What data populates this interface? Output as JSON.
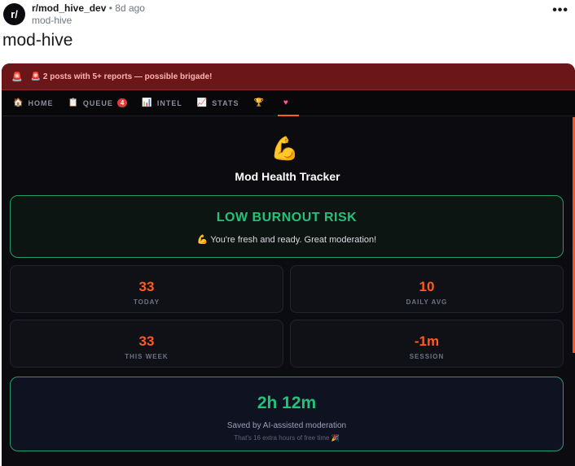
{
  "post": {
    "avatar_text": "r/",
    "subreddit": "r/mod_hive_dev",
    "separator": "•",
    "age": "8d ago",
    "author": "mod-hive",
    "more": "•••",
    "title": "mod-hive"
  },
  "alert": {
    "icon": "🚨",
    "text": "🚨 2 posts with 5+ reports — possible brigade!"
  },
  "nav": {
    "tabs": [
      {
        "icon": "🏠",
        "label": "HOME"
      },
      {
        "icon": "📋",
        "label": "QUEUE",
        "badge": "4"
      },
      {
        "icon": "📊",
        "label": "INTEL"
      },
      {
        "icon": "📈",
        "label": "STATS"
      },
      {
        "icon": "🏆",
        "label": ""
      },
      {
        "icon": "♥",
        "label": ""
      }
    ],
    "active_index": 5
  },
  "health": {
    "icon": "💪",
    "title": "Mod Health Tracker",
    "risk_title": "LOW BURNOUT RISK",
    "risk_sub": "💪 You're fresh and ready. Great moderation!",
    "stats": [
      {
        "value": "33",
        "label": "TODAY"
      },
      {
        "value": "10",
        "label": "DAILY AVG"
      },
      {
        "value": "33",
        "label": "THIS WEEK"
      },
      {
        "value": "-1m",
        "label": "SESSION"
      }
    ],
    "saved_value": "2h 12m",
    "saved_label": "Saved by AI-assisted moderation",
    "saved_note": "That's 16 extra hours of free time 🎉"
  },
  "colors": {
    "accent_orange": "#ff5a1f",
    "accent_green": "#22c27a",
    "alert_bg": "#6b1618"
  }
}
